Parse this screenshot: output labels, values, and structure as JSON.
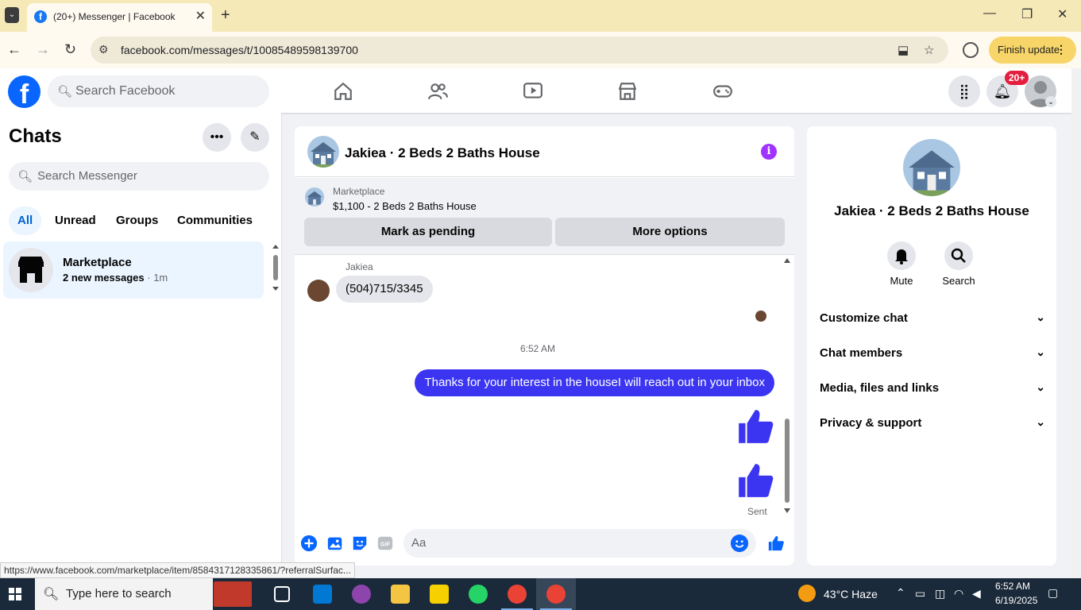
{
  "browser": {
    "tab_title": "(20+) Messenger | Facebook",
    "url": "facebook.com/messages/t/10085489598139700",
    "finish_update": "Finish update",
    "status_url": "https://www.facebook.com/marketplace/item/8584317128335861/?referralSurfac..."
  },
  "fb": {
    "search_placeholder": "Search Facebook",
    "notif_badge": "20+"
  },
  "chats": {
    "title": "Chats",
    "search_placeholder": "Search Messenger",
    "filters": [
      "All",
      "Unread",
      "Groups",
      "Communities"
    ],
    "items": [
      {
        "name": "Marketplace",
        "new_messages": "2 new messages",
        "sep": " · ",
        "time": "1m"
      }
    ]
  },
  "conversation": {
    "title": "Jakiea · 2 Beds 2 Baths House",
    "marketplace_label": "Marketplace",
    "listing": "$1,100 - 2 Beds 2 Baths House",
    "mark_pending": "Mark as pending",
    "more_options": "More options",
    "sender_name": "Jakiea",
    "incoming_message": "(504)715/3345",
    "time_separator": "6:52 AM",
    "outgoing_message": "Thanks for your interest in the houseI will reach out in your inbox",
    "sent_label": "Sent",
    "composer_placeholder": "Aa"
  },
  "info_panel": {
    "name": "Jakiea · 2 Beds 2 Baths House",
    "actions": [
      "Mute",
      "Search"
    ],
    "sections": [
      "Customize chat",
      "Chat members",
      "Media, files and links",
      "Privacy & support"
    ]
  },
  "taskbar": {
    "search_placeholder": "Type here to search",
    "weather": "43°C  Haze",
    "time": "6:52 AM",
    "date": "6/19/2025"
  },
  "colors": {
    "facebook_blue": "#0866ff",
    "messenger_purple": "#3b35f2",
    "info_purple": "#a033ff"
  }
}
